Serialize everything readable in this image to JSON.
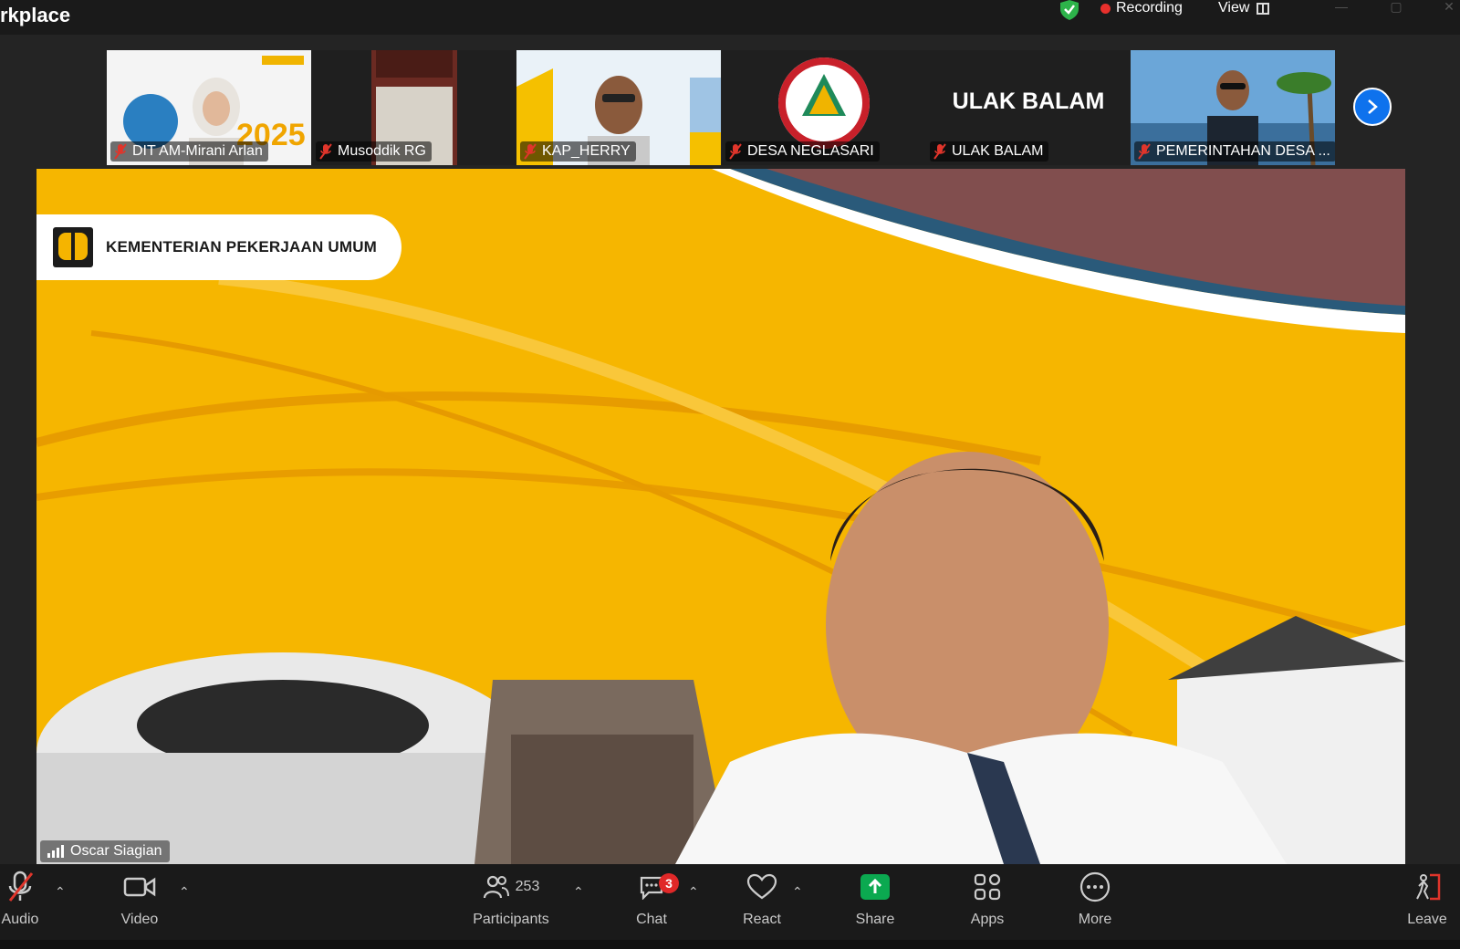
{
  "window": {
    "title_fragment": "rkplace"
  },
  "topbar": {
    "recording_label": "Recording",
    "view_label": "View"
  },
  "thumbnails": [
    {
      "name": "DIT AM-Mirani Arlan"
    },
    {
      "name": "Musoddik RG"
    },
    {
      "name": "KAP_HERRY"
    },
    {
      "name": "DESA NEGLASARI"
    },
    {
      "name": "ULAK BALAM",
      "display_text": "ULAK BALAM"
    },
    {
      "name": "PEMERINTAHAN DESA ..."
    }
  ],
  "main": {
    "speaker_name": "Oscar Siagian",
    "banner_text": "KEMENTERIAN PEKERJAAN UMUM"
  },
  "toolbar": {
    "audio_label": "Audio",
    "video_label": "Video",
    "participants_label": "Participants",
    "participants_count": "253",
    "chat_label": "Chat",
    "chat_badge": "3",
    "react_label": "React",
    "share_label": "Share",
    "apps_label": "Apps",
    "more_label": "More",
    "leave_label": "Leave"
  },
  "colors": {
    "accent": "#0e72ed",
    "recording": "#e8302c",
    "share": "#0ba950",
    "badge": "#e02828",
    "banner": "#f5b400"
  }
}
